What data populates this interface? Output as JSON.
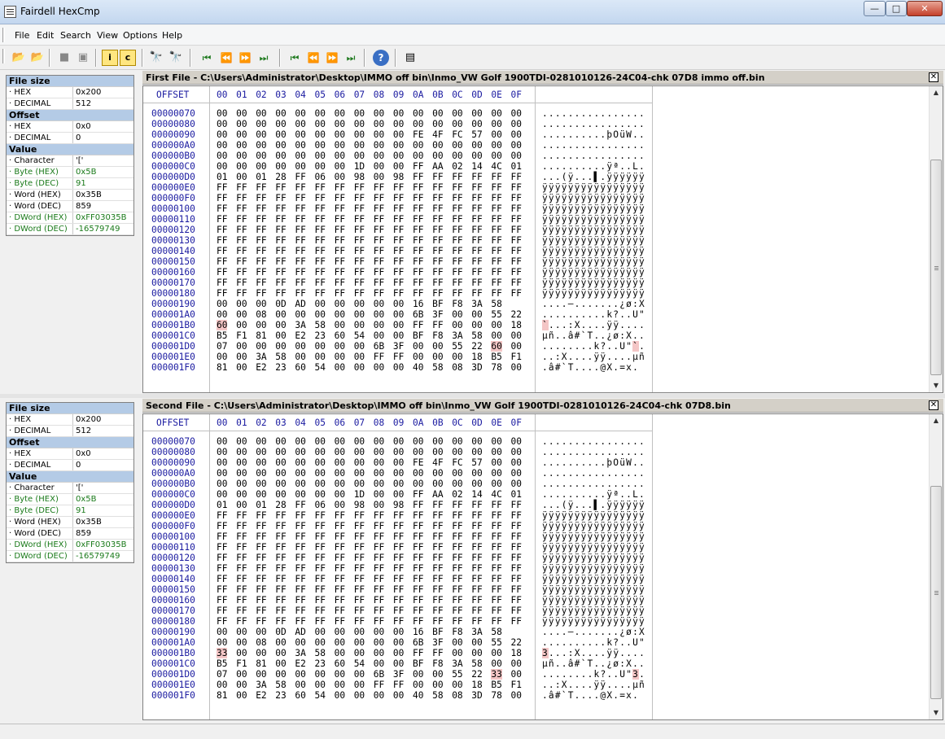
{
  "window": {
    "title": "Fairdell HexCmp",
    "min": "—",
    "max": "□",
    "close": "✕"
  },
  "menu": [
    "File",
    "Edit",
    "Search",
    "View",
    "Options",
    "Help"
  ],
  "toolbar": [
    {
      "name": "open-file1-icon",
      "glyph": "📂"
    },
    {
      "name": "open-file2-icon",
      "glyph": "📂"
    },
    {
      "name": "stop-icon",
      "glyph": "■"
    },
    {
      "name": "pages-icon",
      "glyph": "▣"
    },
    {
      "name": "info-icon",
      "glyph": "i"
    },
    {
      "name": "compare-icon",
      "glyph": "c"
    },
    {
      "name": "find-icon",
      "glyph": "🔭"
    },
    {
      "name": "find-next-icon",
      "glyph": "🔭"
    },
    {
      "name": "first-diff-icon",
      "glyph": "⏮"
    },
    {
      "name": "prev-diff-icon",
      "glyph": "⏪"
    },
    {
      "name": "next-diff-icon",
      "glyph": "⏩"
    },
    {
      "name": "last-diff-icon",
      "glyph": "⏭"
    },
    {
      "name": "first-diff2-icon",
      "glyph": "⏮"
    },
    {
      "name": "prev-diff2-icon",
      "glyph": "⏪"
    },
    {
      "name": "next-diff2-icon",
      "glyph": "⏩"
    },
    {
      "name": "last-diff2-icon",
      "glyph": "⏭"
    },
    {
      "name": "help-icon",
      "glyph": "?"
    },
    {
      "name": "report-icon",
      "glyph": "▤"
    }
  ],
  "props": [
    {
      "sections": [
        {
          "title": "File size",
          "rows": [
            {
              "k": "· HEX",
              "v": "0x200"
            },
            {
              "k": "· DECIMAL",
              "v": "512"
            }
          ]
        },
        {
          "title": "Offset",
          "rows": [
            {
              "k": "· HEX",
              "v": "0x0"
            },
            {
              "k": "· DECIMAL",
              "v": "0"
            }
          ]
        },
        {
          "title": "Value",
          "rows": [
            {
              "k": "· Character",
              "v": "'['"
            },
            {
              "k": "· Byte (HEX)",
              "v": "0x5B",
              "green": true
            },
            {
              "k": "· Byte (DEC)",
              "v": "91",
              "green": true
            },
            {
              "k": "· Word (HEX)",
              "v": "0x35B"
            },
            {
              "k": "· Word (DEC)",
              "v": "859"
            },
            {
              "k": "· DWord (HEX)",
              "v": "0xFF03035B",
              "green": true
            },
            {
              "k": "· DWord (DEC)",
              "v": "-16579749",
              "green": true
            }
          ]
        }
      ]
    },
    {
      "sections": [
        {
          "title": "File size",
          "rows": [
            {
              "k": "· HEX",
              "v": "0x200"
            },
            {
              "k": "· DECIMAL",
              "v": "512"
            }
          ]
        },
        {
          "title": "Offset",
          "rows": [
            {
              "k": "· HEX",
              "v": "0x0"
            },
            {
              "k": "· DECIMAL",
              "v": "0"
            }
          ]
        },
        {
          "title": "Value",
          "rows": [
            {
              "k": "· Character",
              "v": "'['"
            },
            {
              "k": "· Byte (HEX)",
              "v": "0x5B",
              "green": true
            },
            {
              "k": "· Byte (DEC)",
              "v": "91",
              "green": true
            },
            {
              "k": "· Word (HEX)",
              "v": "0x35B"
            },
            {
              "k": "· Word (DEC)",
              "v": "859"
            },
            {
              "k": "· DWord (HEX)",
              "v": "0xFF03035B",
              "green": true
            },
            {
              "k": "· DWord (DEC)",
              "v": "-16579749",
              "green": true
            }
          ]
        }
      ]
    }
  ],
  "panels": [
    {
      "title": "First File - C:\\Users\\Administrator\\Desktop\\IMMO off bin\\Inmo_VW Golf 1900TDI-0281010126-24C04-chk 07D8 immo off.bin",
      "offset_header": "OFFSET",
      "col_headers": [
        "00",
        "01",
        "02",
        "03",
        "04",
        "05",
        "06",
        "07",
        "08",
        "09",
        "0A",
        "0B",
        "0C",
        "0D",
        "0E",
        "0F"
      ],
      "rows": [
        {
          "off": "00000070",
          "hex": "00 00 00 00 00 00 00 00 00 00 00 00 00 00 00 00",
          "ascii": "................",
          "hl": []
        },
        {
          "off": "00000080",
          "hex": "00 00 00 00 00 00 00 00 00 00 00 00 00 00 00 00",
          "ascii": "................",
          "hl": []
        },
        {
          "off": "00000090",
          "hex": "00 00 00 00 00 00 00 00 00 00 FE 4F FC 57 00 00",
          "ascii": "..........þOüW..",
          "hl": []
        },
        {
          "off": "000000A0",
          "hex": "00 00 00 00 00 00 00 00 00 00 00 00 00 00 00 00",
          "ascii": "................",
          "hl": []
        },
        {
          "off": "000000B0",
          "hex": "00 00 00 00 00 00 00 00 00 00 00 00 00 00 00 00",
          "ascii": "................",
          "hl": []
        },
        {
          "off": "000000C0",
          "hex": "00 00 00 00 00 00 00 1D 00 00 FF AA 02 14 4C 01",
          "ascii": "..........ÿª..L.",
          "hl": []
        },
        {
          "off": "000000D0",
          "hex": "01 00 01 28 FF 06 00 98 00 98 FF FF FF FF FF FF",
          "ascii": "...(ÿ...▌.ÿÿÿÿÿÿ",
          "hl": []
        },
        {
          "off": "000000E0",
          "hex": "FF FF FF FF FF FF FF FF FF FF FF FF FF FF FF FF",
          "ascii": "ÿÿÿÿÿÿÿÿÿÿÿÿÿÿÿÿ",
          "hl": []
        },
        {
          "off": "000000F0",
          "hex": "FF FF FF FF FF FF FF FF FF FF FF FF FF FF FF FF",
          "ascii": "ÿÿÿÿÿÿÿÿÿÿÿÿÿÿÿÿ",
          "hl": []
        },
        {
          "off": "00000100",
          "hex": "FF FF FF FF FF FF FF FF FF FF FF FF FF FF FF FF",
          "ascii": "ÿÿÿÿÿÿÿÿÿÿÿÿÿÿÿÿ",
          "hl": []
        },
        {
          "off": "00000110",
          "hex": "FF FF FF FF FF FF FF FF FF FF FF FF FF FF FF FF",
          "ascii": "ÿÿÿÿÿÿÿÿÿÿÿÿÿÿÿÿ",
          "hl": []
        },
        {
          "off": "00000120",
          "hex": "FF FF FF FF FF FF FF FF FF FF FF FF FF FF FF FF",
          "ascii": "ÿÿÿÿÿÿÿÿÿÿÿÿÿÿÿÿ",
          "hl": []
        },
        {
          "off": "00000130",
          "hex": "FF FF FF FF FF FF FF FF FF FF FF FF FF FF FF FF",
          "ascii": "ÿÿÿÿÿÿÿÿÿÿÿÿÿÿÿÿ",
          "hl": []
        },
        {
          "off": "00000140",
          "hex": "FF FF FF FF FF FF FF FF FF FF FF FF FF FF FF FF",
          "ascii": "ÿÿÿÿÿÿÿÿÿÿÿÿÿÿÿÿ",
          "hl": []
        },
        {
          "off": "00000150",
          "hex": "FF FF FF FF FF FF FF FF FF FF FF FF FF FF FF FF",
          "ascii": "ÿÿÿÿÿÿÿÿÿÿÿÿÿÿÿÿ",
          "hl": []
        },
        {
          "off": "00000160",
          "hex": "FF FF FF FF FF FF FF FF FF FF FF FF FF FF FF FF",
          "ascii": "ÿÿÿÿÿÿÿÿÿÿÿÿÿÿÿÿ",
          "hl": []
        },
        {
          "off": "00000170",
          "hex": "FF FF FF FF FF FF FF FF FF FF FF FF FF FF FF FF",
          "ascii": "ÿÿÿÿÿÿÿÿÿÿÿÿÿÿÿÿ",
          "hl": []
        },
        {
          "off": "00000180",
          "hex": "FF FF FF FF FF FF FF FF FF FF FF FF FF FF FF FF",
          "ascii": "ÿÿÿÿÿÿÿÿÿÿÿÿÿÿÿÿ",
          "hl": []
        },
        {
          "off": "00000190",
          "hex": "00 00 00 0D AD 00 00 00 00 00 16 BF F8 3A 58",
          "ascii": "....–.......¿ø:X",
          "hl": []
        },
        {
          "off": "000001A0",
          "hex": "00 00 08 00 00 00 00 00 00 00 6B 3F 00 00 55 22",
          "ascii": "..........k?..U\"",
          "hl": []
        },
        {
          "off": "000001B0",
          "hex": "60 00 00 00 3A 58 00 00 00 00 FF FF 00 00 00 18",
          "ascii": "`...:X....ÿÿ....",
          "hl": [
            0
          ],
          "ahl": [
            0
          ]
        },
        {
          "off": "000001C0",
          "hex": "B5 F1 81 00 E2 23 60 54 00 00 BF F8 3A 58 00 00",
          "ascii": "µñ..â#`T..¿ø:X..",
          "hl": []
        },
        {
          "off": "000001D0",
          "hex": "07 00 00 00 00 00 00 00 6B 3F 00 00 55 22 60 00",
          "ascii": "........k?..U\"`.",
          "hl": [
            14
          ],
          "ahl": [
            14
          ]
        },
        {
          "off": "000001E0",
          "hex": "00 00 3A 58 00 00 00 00 FF FF 00 00 00 18 B5 F1",
          "ascii": "..:X....ÿÿ....µñ",
          "hl": []
        },
        {
          "off": "000001F0",
          "hex": "81 00 E2 23 60 54 00 00 00 00 40 58 08 3D 78 00",
          "ascii": ".â#`T....@X.=x.",
          "hl": []
        }
      ]
    },
    {
      "title": "Second File - C:\\Users\\Administrator\\Desktop\\IMMO off bin\\Inmo_VW Golf 1900TDI-0281010126-24C04-chk 07D8.bin",
      "offset_header": "OFFSET",
      "col_headers": [
        "00",
        "01",
        "02",
        "03",
        "04",
        "05",
        "06",
        "07",
        "08",
        "09",
        "0A",
        "0B",
        "0C",
        "0D",
        "0E",
        "0F"
      ],
      "rows": [
        {
          "off": "00000070",
          "hex": "00 00 00 00 00 00 00 00 00 00 00 00 00 00 00 00",
          "ascii": "................",
          "hl": []
        },
        {
          "off": "00000080",
          "hex": "00 00 00 00 00 00 00 00 00 00 00 00 00 00 00 00",
          "ascii": "................",
          "hl": []
        },
        {
          "off": "00000090",
          "hex": "00 00 00 00 00 00 00 00 00 00 FE 4F FC 57 00 00",
          "ascii": "..........þOüW..",
          "hl": []
        },
        {
          "off": "000000A0",
          "hex": "00 00 00 00 00 00 00 00 00 00 00 00 00 00 00 00",
          "ascii": "................",
          "hl": []
        },
        {
          "off": "000000B0",
          "hex": "00 00 00 00 00 00 00 00 00 00 00 00 00 00 00 00",
          "ascii": "................",
          "hl": []
        },
        {
          "off": "000000C0",
          "hex": "00 00 00 00 00 00 00 1D 00 00 FF AA 02 14 4C 01",
          "ascii": "..........ÿª..L.",
          "hl": []
        },
        {
          "off": "000000D0",
          "hex": "01 00 01 28 FF 06 00 98 00 98 FF FF FF FF FF FF",
          "ascii": "...(ÿ...▌.ÿÿÿÿÿÿ",
          "hl": []
        },
        {
          "off": "000000E0",
          "hex": "FF FF FF FF FF FF FF FF FF FF FF FF FF FF FF FF",
          "ascii": "ÿÿÿÿÿÿÿÿÿÿÿÿÿÿÿÿ",
          "hl": []
        },
        {
          "off": "000000F0",
          "hex": "FF FF FF FF FF FF FF FF FF FF FF FF FF FF FF FF",
          "ascii": "ÿÿÿÿÿÿÿÿÿÿÿÿÿÿÿÿ",
          "hl": []
        },
        {
          "off": "00000100",
          "hex": "FF FF FF FF FF FF FF FF FF FF FF FF FF FF FF FF",
          "ascii": "ÿÿÿÿÿÿÿÿÿÿÿÿÿÿÿÿ",
          "hl": []
        },
        {
          "off": "00000110",
          "hex": "FF FF FF FF FF FF FF FF FF FF FF FF FF FF FF FF",
          "ascii": "ÿÿÿÿÿÿÿÿÿÿÿÿÿÿÿÿ",
          "hl": []
        },
        {
          "off": "00000120",
          "hex": "FF FF FF FF FF FF FF FF FF FF FF FF FF FF FF FF",
          "ascii": "ÿÿÿÿÿÿÿÿÿÿÿÿÿÿÿÿ",
          "hl": []
        },
        {
          "off": "00000130",
          "hex": "FF FF FF FF FF FF FF FF FF FF FF FF FF FF FF FF",
          "ascii": "ÿÿÿÿÿÿÿÿÿÿÿÿÿÿÿÿ",
          "hl": []
        },
        {
          "off": "00000140",
          "hex": "FF FF FF FF FF FF FF FF FF FF FF FF FF FF FF FF",
          "ascii": "ÿÿÿÿÿÿÿÿÿÿÿÿÿÿÿÿ",
          "hl": []
        },
        {
          "off": "00000150",
          "hex": "FF FF FF FF FF FF FF FF FF FF FF FF FF FF FF FF",
          "ascii": "ÿÿÿÿÿÿÿÿÿÿÿÿÿÿÿÿ",
          "hl": []
        },
        {
          "off": "00000160",
          "hex": "FF FF FF FF FF FF FF FF FF FF FF FF FF FF FF FF",
          "ascii": "ÿÿÿÿÿÿÿÿÿÿÿÿÿÿÿÿ",
          "hl": []
        },
        {
          "off": "00000170",
          "hex": "FF FF FF FF FF FF FF FF FF FF FF FF FF FF FF FF",
          "ascii": "ÿÿÿÿÿÿÿÿÿÿÿÿÿÿÿÿ",
          "hl": []
        },
        {
          "off": "00000180",
          "hex": "FF FF FF FF FF FF FF FF FF FF FF FF FF FF FF FF",
          "ascii": "ÿÿÿÿÿÿÿÿÿÿÿÿÿÿÿÿ",
          "hl": []
        },
        {
          "off": "00000190",
          "hex": "00 00 00 0D AD 00 00 00 00 00 16 BF F8 3A 58",
          "ascii": "....–.......¿ø:X",
          "hl": []
        },
        {
          "off": "000001A0",
          "hex": "00 00 08 00 00 00 00 00 00 00 6B 3F 00 00 55 22",
          "ascii": "..........k?..U\"",
          "hl": []
        },
        {
          "off": "000001B0",
          "hex": "33 00 00 00 3A 58 00 00 00 00 FF FF 00 00 00 18",
          "ascii": "3...:X....ÿÿ....",
          "hl": [
            0
          ],
          "ahl": [
            0
          ]
        },
        {
          "off": "000001C0",
          "hex": "B5 F1 81 00 E2 23 60 54 00 00 BF F8 3A 58 00 00",
          "ascii": "µñ..â#`T..¿ø:X..",
          "hl": []
        },
        {
          "off": "000001D0",
          "hex": "07 00 00 00 00 00 00 00 6B 3F 00 00 55 22 33 00",
          "ascii": "........k?..U\"3.",
          "hl": [
            14
          ],
          "ahl": [
            14
          ]
        },
        {
          "off": "000001E0",
          "hex": "00 00 3A 58 00 00 00 00 FF FF 00 00 00 18 B5 F1",
          "ascii": "..:X....ÿÿ....µñ",
          "hl": []
        },
        {
          "off": "000001F0",
          "hex": "81 00 E2 23 60 54 00 00 00 00 40 58 08 3D 78 00",
          "ascii": ".â#`T....@X.=x.",
          "hl": []
        }
      ]
    }
  ],
  "colors": {
    "highlight": "#f4c6c6",
    "hex_header": "#1a1aa0",
    "section_header": "#b4cbe6"
  }
}
